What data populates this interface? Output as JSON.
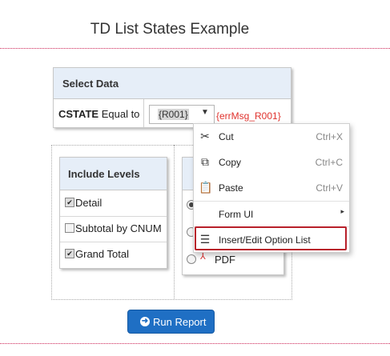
{
  "page": {
    "title": "TD List States Example"
  },
  "select_data": {
    "header": "Select Data",
    "field_name": "CSTATE",
    "operator_label": "Equal to",
    "selected_value": "{R001}",
    "error_message": "{errMsg_R001}"
  },
  "include_levels": {
    "header": "Include Levels",
    "items": [
      {
        "label": "Detail",
        "checked": true
      },
      {
        "label": "Subtotal by CNUM",
        "checked": false
      },
      {
        "label": "Grand Total",
        "checked": true
      }
    ]
  },
  "output_format": {
    "visible_option": "PDF"
  },
  "context_menu": {
    "items": [
      {
        "label": "Cut",
        "shortcut": "Ctrl+X",
        "icon": "scissors-icon"
      },
      {
        "label": "Copy",
        "shortcut": "Ctrl+C",
        "icon": "copy-icon"
      },
      {
        "label": "Paste",
        "shortcut": "Ctrl+V",
        "icon": "paste-icon"
      },
      {
        "label": "Form UI",
        "icon": "submenu-arrow-icon"
      },
      {
        "label": "Insert/Edit Option List",
        "icon": "list-icon",
        "highlighted": true
      }
    ],
    "highlight_color": "#b8202a"
  },
  "run_button": {
    "label": "Run Report",
    "color": "#1f6fc4"
  }
}
